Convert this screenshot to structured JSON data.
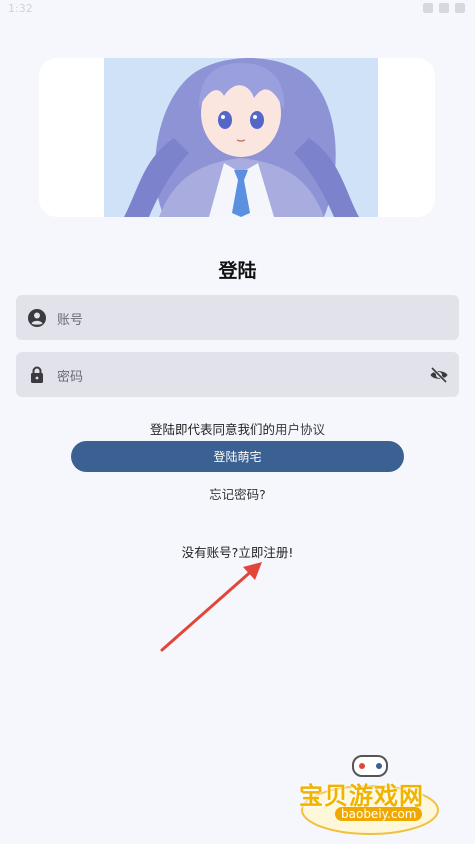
{
  "status_bar": {
    "time": "1:32"
  },
  "page": {
    "title": "登陆"
  },
  "account_field": {
    "placeholder": "账号",
    "icon": "user-icon"
  },
  "password_field": {
    "placeholder": "密码",
    "icon": "lock-icon",
    "toggle_icon": "eye-off-icon"
  },
  "agreement": {
    "prefix": "登陆即代表同意我们的",
    "link": "用户协议"
  },
  "login_button": {
    "label": "登陆萌宅"
  },
  "forgot_password": {
    "label": "忘记密码?"
  },
  "register": {
    "prefix": "没有账号?",
    "link": "立即注册!"
  },
  "watermark": {
    "brand": "宝贝游戏网",
    "url": "baobeiy.com"
  },
  "colors": {
    "background": "#f6f7fd",
    "field": "#e2e2ea",
    "primary_button": "#3a6192",
    "arrow": "#e2463a",
    "watermark": "#f0b400"
  }
}
